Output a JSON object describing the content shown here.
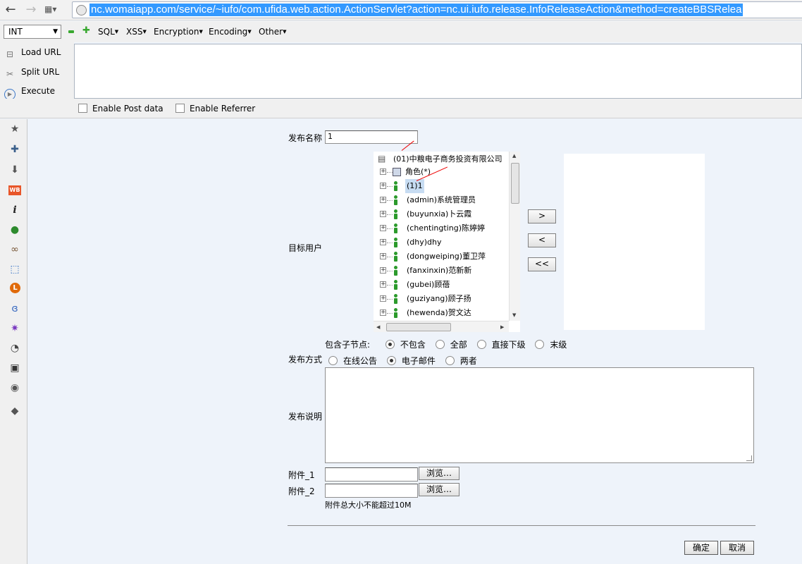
{
  "browser": {
    "url": "nc.womaiapp.com/service/~iufo/com.ufida.web.action.ActionServlet?action=nc.ui.iufo.release.InfoReleaseAction&method=createBBSRelea"
  },
  "hackbar": {
    "type_select": "INT",
    "menus": [
      "SQL",
      "XSS",
      "Encryption",
      "Encoding",
      "Other"
    ],
    "load_url": "Load URL",
    "split_url": "Split URL",
    "execute": "Execute",
    "enable_post": "Enable Post data",
    "enable_referrer": "Enable Referrer"
  },
  "form": {
    "name_label": "发布名称",
    "name_value": "1",
    "target_label": "目标用户",
    "tree": {
      "root": "(01)中粮电子商务投资有限公司",
      "role": "角色(*)",
      "users": [
        "(1)1",
        "(admin)系统管理员",
        "(buyunxia)卜云霞",
        "(chentingting)陈婷婷",
        "(dhy)dhy",
        "(dongweiping)董卫萍",
        "(fanxinxin)范新新",
        "(gubei)顾蓓",
        "(guziyang)顾子扬",
        "(hewenda)贺文达"
      ]
    },
    "move_buttons": [
      ">",
      "<",
      "<<"
    ],
    "include_label": "包含子节点:",
    "include_options": [
      "不包含",
      "全部",
      "直接下级",
      "末级"
    ],
    "method_label": "发布方式",
    "method_options": [
      "在线公告",
      "电子邮件",
      "两者"
    ],
    "desc_label": "发布说明",
    "attach1_label": "附件_1",
    "attach2_label": "附件_2",
    "browse": "浏览…",
    "attach_note": "附件总大小不能超过10M",
    "ok": "确定",
    "cancel": "取消"
  }
}
